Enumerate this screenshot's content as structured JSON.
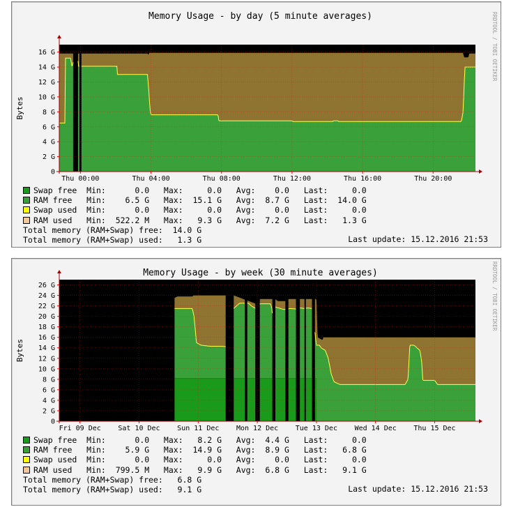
{
  "colors": {
    "swap_free": "#1a9a1a",
    "ram_free": "#3aa13a",
    "swap_used": "#ffff00",
    "ram_used": "#8e7331",
    "ram_used_legend": "#f2c89a",
    "canvas_bg": "#000000",
    "grid": "#ff0000",
    "line": "#ffff4f"
  },
  "vendor_label": "RRDTOOL / TOBI OETIKER",
  "chart_data": [
    {
      "id": "day",
      "type": "area",
      "title": "Memory Usage - by day (5 minute averages)",
      "ylabel": "Bytes",
      "ylim": [
        0,
        17
      ],
      "yticks": [
        {
          "v": 0,
          "label": "0"
        },
        {
          "v": 2,
          "label": "2 G"
        },
        {
          "v": 4,
          "label": "4 G"
        },
        {
          "v": 6,
          "label": "6 G"
        },
        {
          "v": 8,
          "label": "8 G"
        },
        {
          "v": 10,
          "label": "10 G"
        },
        {
          "v": 12,
          "label": "12 G"
        },
        {
          "v": 14,
          "label": "14 G"
        },
        {
          "v": 16,
          "label": "16 G"
        }
      ],
      "xrange": [
        -1.2,
        22.4
      ],
      "xticks": [
        {
          "v": 0,
          "label": "Thu 00:00"
        },
        {
          "v": 4,
          "label": "Thu 04:00"
        },
        {
          "v": 8,
          "label": "Thu 08:00"
        },
        {
          "v": 12,
          "label": "Thu 12:00"
        },
        {
          "v": 16,
          "label": "Thu 16:00"
        },
        {
          "v": 20,
          "label": "Thu 20:00"
        }
      ],
      "gaps": [
        [
          -0.4,
          -0.15
        ],
        [
          -0.05,
          0.05
        ]
      ],
      "total": [
        [
          -1.2,
          15.8
        ],
        [
          3.8,
          15.8
        ],
        [
          3.85,
          15.6
        ],
        [
          3.9,
          15.9
        ],
        [
          6,
          15.9
        ],
        [
          8,
          15.9
        ],
        [
          21.7,
          15.9
        ],
        [
          21.75,
          15.3
        ],
        [
          22.0,
          15.3
        ],
        [
          22.05,
          15.8
        ],
        [
          22.4,
          15.8
        ]
      ],
      "ram_free": [
        [
          -1.2,
          6.5
        ],
        [
          -0.86,
          6.5
        ],
        [
          -0.85,
          15.2
        ],
        [
          -0.55,
          15.2
        ],
        [
          -0.5,
          14.2
        ],
        [
          -0.43,
          14.2
        ],
        [
          -0.4,
          15.0
        ],
        [
          -0.15,
          15.0
        ],
        [
          -0.1,
          14.1
        ],
        [
          0.0,
          14.1
        ],
        [
          0.05,
          14.1
        ],
        [
          2.0,
          14.1
        ],
        [
          2.05,
          14.0
        ],
        [
          2.05,
          14.1
        ],
        [
          2.0,
          14.1
        ],
        [
          2.0,
          14.1
        ],
        [
          2.05,
          14.1
        ],
        [
          2.1,
          14.1
        ],
        [
          2.1,
          14.0
        ],
        [
          2.1,
          13.0
        ],
        [
          3.8,
          13.0
        ],
        [
          3.82,
          12.5
        ],
        [
          3.9,
          10.0
        ],
        [
          3.95,
          8.4
        ],
        [
          4.0,
          7.6
        ],
        [
          7.8,
          7.6
        ],
        [
          7.85,
          6.8
        ],
        [
          12.0,
          6.8
        ],
        [
          12.05,
          6.7
        ],
        [
          14.3,
          6.7
        ],
        [
          14.35,
          6.8
        ],
        [
          14.6,
          6.8
        ],
        [
          14.65,
          6.7
        ],
        [
          21.6,
          6.7
        ],
        [
          21.7,
          8.0
        ],
        [
          21.8,
          14.0
        ],
        [
          22.4,
          14.0
        ]
      ],
      "legend": [
        {
          "key": "swap_free",
          "label": "Swap free",
          "min": "0.0",
          "max": "0.0",
          "avg": "0.0",
          "last": "0.0"
        },
        {
          "key": "ram_free",
          "label": "RAM free",
          "min": "6.5 G",
          "max": "15.1 G",
          "avg": "8.7 G",
          "last": "14.0 G"
        },
        {
          "key": "swap_used",
          "label": "Swap used",
          "min": "0.0",
          "max": "0.0",
          "avg": "0.0",
          "last": "0.0"
        },
        {
          "key": "ram_used",
          "label": "RAM used",
          "min": "522.2 M",
          "max": "9.3 G",
          "avg": "7.2 G",
          "last": "1.3 G"
        }
      ],
      "total_free": "Total memory (RAM+Swap) free:  14.0 G",
      "total_used": "Total memory (RAM+Swap) used:   1.3 G",
      "last_update": "Last update: 15.12.2016 21:53"
    },
    {
      "id": "week",
      "type": "area",
      "title": "Memory Usage - by week (30 minute averages)",
      "ylabel": "Bytes",
      "ylim": [
        0,
        27
      ],
      "yticks": [
        {
          "v": 0,
          "label": "0"
        },
        {
          "v": 2,
          "label": "2 G"
        },
        {
          "v": 4,
          "label": "4 G"
        },
        {
          "v": 6,
          "label": "6 G"
        },
        {
          "v": 8,
          "label": "8 G"
        },
        {
          "v": 10,
          "label": "10 G"
        },
        {
          "v": 12,
          "label": "12 G"
        },
        {
          "v": 14,
          "label": "14 G"
        },
        {
          "v": 16,
          "label": "16 G"
        },
        {
          "v": 18,
          "label": "18 G"
        },
        {
          "v": 20,
          "label": "20 G"
        },
        {
          "v": 22,
          "label": "22 G"
        },
        {
          "v": 24,
          "label": "24 G"
        },
        {
          "v": 26,
          "label": "26 G"
        }
      ],
      "xrange": [
        -0.35,
        6.69
      ],
      "xticks": [
        {
          "v": 0,
          "label": "Fri 09 Dec"
        },
        {
          "v": 1,
          "label": "Sat 10 Dec"
        },
        {
          "v": 2,
          "label": "Sun 11 Dec"
        },
        {
          "v": 3,
          "label": "Mon 12 Dec"
        },
        {
          "v": 4,
          "label": "Tue 13 Dec"
        },
        {
          "v": 5,
          "label": "Wed 14 Dec"
        },
        {
          "v": 6,
          "label": "Thu 15 Dec"
        }
      ],
      "data_start": 1.6,
      "gaps": [
        [
          2.47,
          2.6
        ],
        [
          2.79,
          2.83
        ],
        [
          2.97,
          3.04
        ],
        [
          3.26,
          3.3
        ],
        [
          3.48,
          3.52
        ],
        [
          3.66,
          3.72
        ],
        [
          3.8,
          3.82
        ],
        [
          3.93,
          3.97
        ]
      ],
      "total": [
        [
          1.6,
          23.5
        ],
        [
          1.65,
          23.8
        ],
        [
          1.9,
          23.8
        ],
        [
          1.92,
          24.0
        ],
        [
          2.5,
          24.0
        ],
        [
          2.6,
          24.0
        ],
        [
          3.0,
          22.3
        ],
        [
          3.05,
          23.3
        ],
        [
          3.3,
          23.3
        ],
        [
          3.35,
          22.9
        ],
        [
          3.5,
          22.9
        ],
        [
          3.52,
          23.3
        ],
        [
          3.7,
          23.3
        ],
        [
          3.75,
          23.3
        ],
        [
          4.0,
          23.3
        ],
        [
          4.02,
          16.0
        ],
        [
          4.1,
          15.5
        ],
        [
          4.12,
          16.0
        ],
        [
          6.69,
          16.0
        ]
      ],
      "ram_free": [
        [
          1.6,
          21.5
        ],
        [
          1.9,
          21.5
        ],
        [
          1.93,
          20.0
        ],
        [
          1.97,
          15.0
        ],
        [
          2.05,
          14.5
        ],
        [
          2.2,
          14.3
        ],
        [
          2.4,
          14.3
        ],
        [
          2.47,
          14.2
        ],
        [
          2.6,
          21.5
        ],
        [
          2.7,
          22.5
        ],
        [
          2.85,
          22.5
        ],
        [
          2.9,
          22.0
        ],
        [
          2.97,
          21.5
        ],
        [
          3.05,
          22.4
        ],
        [
          3.22,
          22.4
        ],
        [
          3.25,
          21.5
        ],
        [
          3.28,
          15.0
        ],
        [
          3.3,
          21.8
        ],
        [
          3.45,
          21.3
        ],
        [
          3.55,
          21.5
        ],
        [
          3.66,
          21.4
        ],
        [
          3.72,
          21.6
        ],
        [
          3.8,
          21.5
        ],
        [
          3.85,
          21.6
        ],
        [
          3.93,
          21.5
        ],
        [
          4.0,
          14.5
        ],
        [
          4.05,
          14.5
        ],
        [
          4.08,
          14.0
        ],
        [
          4.15,
          13.5
        ],
        [
          4.2,
          12.0
        ],
        [
          4.25,
          9.0
        ],
        [
          4.3,
          7.5
        ],
        [
          4.4,
          7.0
        ],
        [
          5.2,
          7.0
        ],
        [
          5.5,
          7.0
        ],
        [
          5.55,
          8.0
        ],
        [
          5.58,
          14.5
        ],
        [
          5.65,
          14.5
        ],
        [
          5.75,
          13.5
        ],
        [
          5.78,
          11.5
        ],
        [
          5.8,
          7.8
        ],
        [
          6.0,
          7.8
        ],
        [
          6.05,
          7.0
        ],
        [
          6.69,
          7.0
        ]
      ],
      "swap_free": [
        [
          1.6,
          8.2
        ],
        [
          6.69,
          0.0
        ]
      ],
      "legend": [
        {
          "key": "swap_free",
          "label": "Swap free",
          "min": "0.0",
          "max": "8.2 G",
          "avg": "4.4 G",
          "last": "0.0"
        },
        {
          "key": "ram_free",
          "label": "RAM free",
          "min": "5.9 G",
          "max": "14.9 G",
          "avg": "8.9 G",
          "last": "6.8 G"
        },
        {
          "key": "swap_used",
          "label": "Swap used",
          "min": "0.0",
          "max": "0.0",
          "avg": "0.0",
          "last": "0.0"
        },
        {
          "key": "ram_used",
          "label": "RAM used",
          "min": "799.5 M",
          "max": "9.9 G",
          "avg": "6.8 G",
          "last": "9.1 G"
        }
      ],
      "total_free": "Total memory (RAM+Swap) free:   6.8 G",
      "total_used": "Total memory (RAM+Swap) used:   9.1 G",
      "last_update": "Last update: 15.12.2016 21:53"
    }
  ]
}
